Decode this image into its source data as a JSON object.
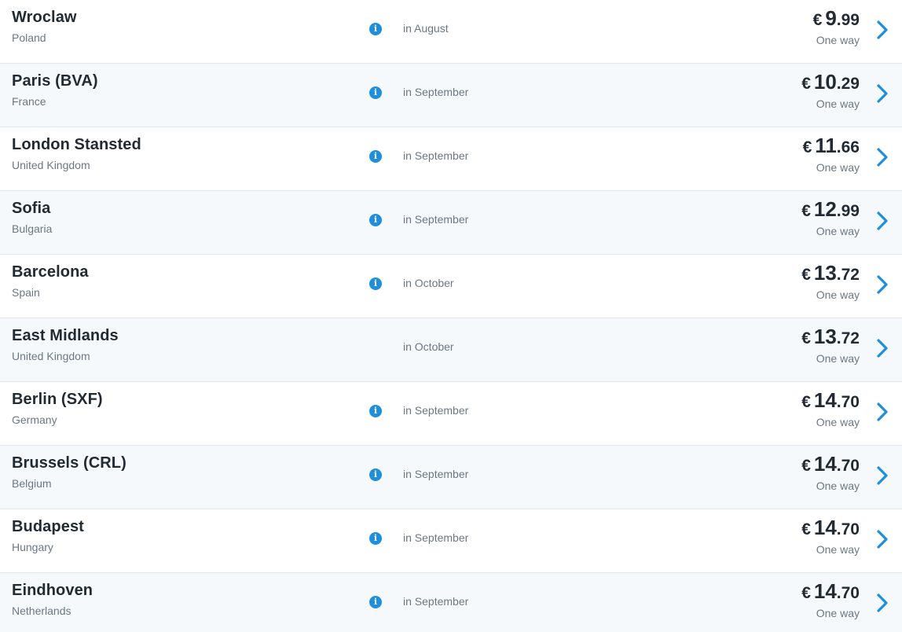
{
  "theme": {
    "accent": "#1e8fdc",
    "row_alt_bg": "#f6f9fc",
    "divider": "#dfe6ee",
    "title_color": "#222a33",
    "muted_color": "#6c7783"
  },
  "icons": {
    "info": "info-icon",
    "chevron": "chevron-right-icon"
  },
  "flights": [
    {
      "city": "Wroclaw",
      "country": "Poland",
      "has_info": true,
      "month": "in August",
      "currency": "€",
      "price_int": "9",
      "price_dec": ".99",
      "trip": "One way"
    },
    {
      "city": "Paris (BVA)",
      "country": "France",
      "has_info": true,
      "month": "in September",
      "currency": "€",
      "price_int": "10",
      "price_dec": ".29",
      "trip": "One way"
    },
    {
      "city": "London Stansted",
      "country": "United Kingdom",
      "has_info": true,
      "month": "in September",
      "currency": "€",
      "price_int": "11",
      "price_dec": ".66",
      "trip": "One way"
    },
    {
      "city": "Sofia",
      "country": "Bulgaria",
      "has_info": true,
      "month": "in September",
      "currency": "€",
      "price_int": "12",
      "price_dec": ".99",
      "trip": "One way"
    },
    {
      "city": "Barcelona",
      "country": "Spain",
      "has_info": true,
      "month": "in October",
      "currency": "€",
      "price_int": "13",
      "price_dec": ".72",
      "trip": "One way"
    },
    {
      "city": "East Midlands",
      "country": "United Kingdom",
      "has_info": false,
      "month": "in October",
      "currency": "€",
      "price_int": "13",
      "price_dec": ".72",
      "trip": "One way"
    },
    {
      "city": "Berlin (SXF)",
      "country": "Germany",
      "has_info": true,
      "month": "in September",
      "currency": "€",
      "price_int": "14",
      "price_dec": ".70",
      "trip": "One way"
    },
    {
      "city": "Brussels (CRL)",
      "country": "Belgium",
      "has_info": true,
      "month": "in September",
      "currency": "€",
      "price_int": "14",
      "price_dec": ".70",
      "trip": "One way"
    },
    {
      "city": "Budapest",
      "country": "Hungary",
      "has_info": true,
      "month": "in September",
      "currency": "€",
      "price_int": "14",
      "price_dec": ".70",
      "trip": "One way"
    },
    {
      "city": "Eindhoven",
      "country": "Netherlands",
      "has_info": true,
      "month": "in September",
      "currency": "€",
      "price_int": "14",
      "price_dec": ".70",
      "trip": "One way"
    }
  ]
}
